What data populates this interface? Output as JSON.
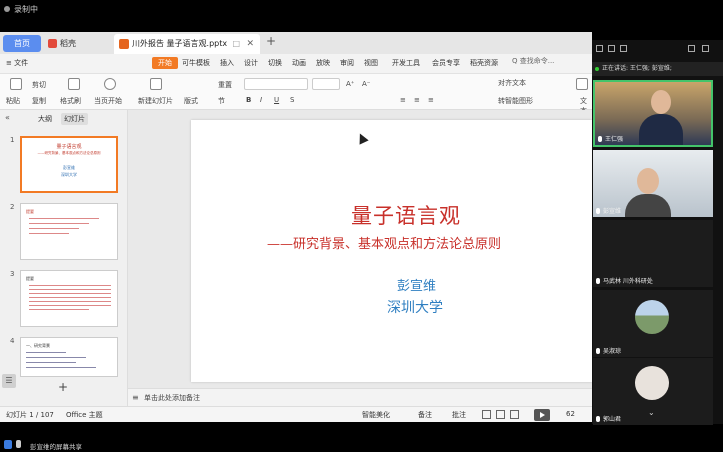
{
  "recorder": {
    "label": "录制中"
  },
  "wps": {
    "tabs": {
      "home": "首页",
      "daoke": "稻壳",
      "file": "川外报告 量子语言观.pptx",
      "close": "✕",
      "plus": "+"
    },
    "menu": {
      "file": "≡ 文件",
      "start": "开始",
      "items": [
        "可牛模板",
        "插入",
        "设计",
        "切换",
        "动画",
        "放映",
        "审阅",
        "视图",
        "开发工具",
        "会员专享",
        "稻壳资源"
      ],
      "search": "Q 查找命令..."
    },
    "ribbon": {
      "paste": "粘贴",
      "cut": "剪切",
      "copy": "复制",
      "format_painter": "格式刷",
      "from_start": "当页开始",
      "new_slide": "新建幻灯片",
      "layout": "版式",
      "reset": "重置",
      "section": "节",
      "text_box": "文本框",
      "text_align": "对齐文本",
      "smart_art": "转智能图形"
    },
    "side": {
      "collapse": "«",
      "tab_outline": "大纲",
      "tab_slides": "幻灯片",
      "thumbs": [
        {
          "num": "1",
          "title": "量子语言观",
          "sub": "——研究背景、基本观点和方法论总原则",
          "author": "彭宣维",
          "org": "深圳大学"
        },
        {
          "num": "2",
          "heading": "提要"
        },
        {
          "num": "3",
          "heading": "提要"
        },
        {
          "num": "4",
          "heading": "一、研究背景"
        }
      ],
      "add": "+",
      "list_icon": "☰"
    },
    "slide": {
      "title": "量子语言观",
      "subtitle": "——研究背景、基本观点和方法论总原则",
      "author": "彭宣维",
      "org": "深圳大学"
    },
    "notes": {
      "placeholder": "单击此处添加备注",
      "icon": "≡"
    },
    "status": {
      "slide_count": "幻灯片 1 / 107",
      "theme": "Office 主题",
      "beautify": "智能美化",
      "notes": "备注",
      "comments": "批注",
      "zoom": "62"
    }
  },
  "meeting": {
    "speaking": "正在讲话: 王仁强; 彭宣维;",
    "participants": [
      {
        "name": "王仁强"
      },
      {
        "name": "彭宣维"
      },
      {
        "name": "马武林 川外科研处"
      },
      {
        "name": "吴淑琼"
      },
      {
        "name": "郭山君"
      }
    ],
    "more": "⌄"
  },
  "share_bar": {
    "text": "彭宣维的屏幕共享"
  }
}
